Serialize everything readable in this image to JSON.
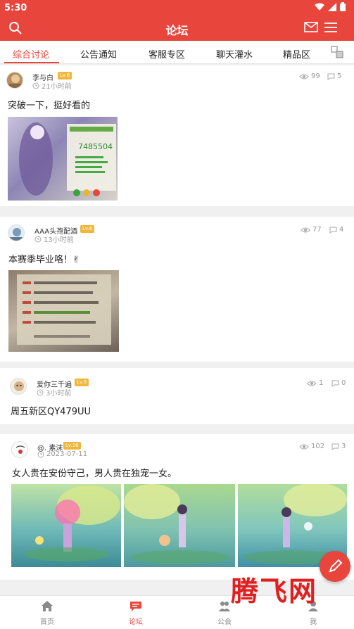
{
  "status_bar": {
    "time": "5:30"
  },
  "app_bar": {
    "title": "论坛",
    "search_icon": "search-icon",
    "mail_icon": "mail-icon",
    "menu_icon": "menu-icon"
  },
  "tabs": [
    {
      "label": "综合讨论",
      "active": true
    },
    {
      "label": "公告通知",
      "active": false
    },
    {
      "label": "客服专区",
      "active": false
    },
    {
      "label": "聊天灌水",
      "active": false
    },
    {
      "label": "精品区",
      "active": false
    }
  ],
  "posts": [
    {
      "username": "李与白",
      "level": "Lv.6",
      "time": "21小时前",
      "views": "99",
      "comments": "5",
      "text": "突破一下，挺好看的",
      "images": 1
    },
    {
      "username": "AAA头孢配酒",
      "level": "Lv.6",
      "time": "13小时前",
      "views": "77",
      "comments": "4",
      "text": "本赛季毕业咯！✌",
      "images": 1
    },
    {
      "username": "爱你三千遍",
      "level": "Lv.6",
      "time": "3小时前",
      "views": "1",
      "comments": "0",
      "text": "周五新区QY479UU",
      "images": 0
    },
    {
      "username": "@. 素沫",
      "level": "Lv.16",
      "time": "2023-07-11",
      "views": "102",
      "comments": "3",
      "text": "女人贵在安份守己，男人贵在独宠一女。",
      "images": 3
    }
  ],
  "screenshot_overlay": {
    "game_stat": "7485504"
  },
  "bottom_nav": [
    {
      "label": "首页",
      "icon": "home-icon",
      "active": false
    },
    {
      "label": "论坛",
      "icon": "chat-icon",
      "active": true
    },
    {
      "label": "公会",
      "icon": "guild-icon",
      "active": false
    },
    {
      "label": "我",
      "icon": "user-icon",
      "active": false
    }
  ],
  "watermark": "腾飞网",
  "colors": {
    "primary": "#e8453c",
    "level_badge": "#f0b73c",
    "background": "#f0f0f0"
  }
}
